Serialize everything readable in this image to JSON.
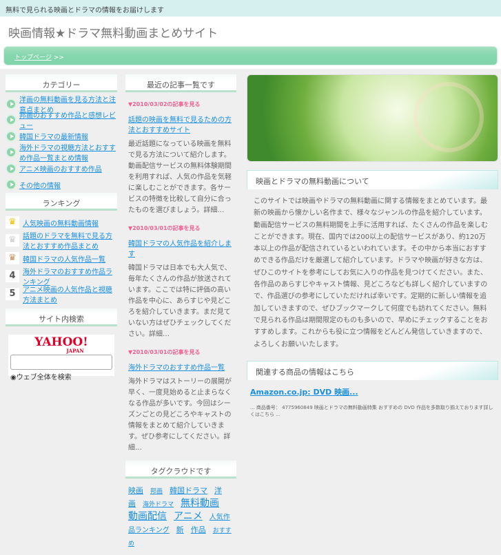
{
  "topbar": {
    "text": "無料で見られる映画とドラマの情報をお届けします"
  },
  "header": {
    "title": "映画情報★ドラマ無料動画まとめサイト"
  },
  "nav": {
    "home": "トップページ",
    "sep": " >>"
  },
  "left": {
    "categories_title": "カテゴリー",
    "categories": [
      "洋画の無料動画を見る方法と注意点まとめ",
      "邦画のおすすめ作品と感想レビュー",
      "韓国ドラマの最新情報",
      "海外ドラマの視聴方法とおすすめ作品一覧まとめ情報",
      "アニメ映画のおすすめ作品",
      "その他の情報"
    ],
    "ranking_title": "ランキング",
    "ranking": [
      {
        "rank": "1",
        "label": "人気映画の無料動画情報"
      },
      {
        "rank": "2",
        "label": "話題のドラマを無料で見る方法とおすすめ作品まとめ"
      },
      {
        "rank": "3",
        "label": "韓国ドラマの人気作品一覧"
      },
      {
        "rank": "4",
        "label": "海外ドラマのおすすめ作品ランキング"
      },
      {
        "rank": "5",
        "label": "アニメ映画の人気作品と視聴方法まとめ"
      }
    ],
    "search_title": "サイト内検索",
    "yahoo_logo": "YAHOO!",
    "yahoo_sub": "JAPAN",
    "search_placeholder": "",
    "radio_label": "ウェブ全体を検索"
  },
  "mid": {
    "recent_title": "最近の記事一覧です",
    "entries": [
      {
        "date": "▼2010/03/02",
        "date_suffix": "の記事を見る",
        "title": "話題の映画を無料で見るための方法とおすすめサイト",
        "body": "最近話題になっている映画を無料で見る方法について紹介します。動画配信サービスの無料体験期間を利用すれば、人気の作品を気軽に楽しむことができます。各サービスの特徴を比較して自分に合ったものを選びましょう。詳細…"
      },
      {
        "date": "▼2010/03/01",
        "date_suffix": "の記事を見る",
        "title": "韓国ドラマの人気作品を紹介します",
        "body": "韓国ドラマは日本でも大人気で、毎年たくさんの作品が放送されています。ここでは特に評価の高い作品を中心に、あらすじや見どころを紹介していきます。まだ見ていない方はぜひチェックしてください。詳細…"
      },
      {
        "date": "▼2010/03/01",
        "date_suffix": "の記事を見る",
        "title": "海外ドラマのおすすめ作品一覧",
        "body": "海外ドラマはストーリーの展開が早く、一度見始めると止まらなくなる作品が多いです。今回はシーズンごとの見どころやキャストの情報をまとめて紹介していきます。ぜひ参考にしてください。詳細…"
      }
    ],
    "tags_title": "タグクラウドです",
    "tags": [
      "映画",
      "邦画",
      "韓国ドラマ",
      "洋画",
      "海外ドラマ",
      "無料動画",
      "動画配信",
      "アニメ",
      "人気作品ランキング",
      "新",
      "作品",
      "おすすめ"
    ]
  },
  "right": {
    "intro_title": "映画とドラマの無料動画について",
    "intro_body": "このサイトでは映画やドラマの無料動画に関する情報をまとめています。最新の映画から懐かしい名作まで、様々なジャンルの作品を紹介しています。動画配信サービスの無料期間を上手に活用すれば、たくさんの作品を楽しむことができます。現在、国内では200以上の配信サービスがあり、約120万本以上の作品が配信されているといわれています。その中から本当におすすめできる作品だけを厳選して紹介しています。ドラマや映画が好きな方は、ぜひこのサイトを参考にしてお気に入りの作品を見つけてください。また、各作品のあらすじやキャスト情報、見どころなども詳しく紹介していますので、作品選びの参考にしていただければ幸いです。定期的に新しい情報を追加していきますので、ぜひブックマークして何度でも訪れてください。無料で見られる作品は期間限定のものも多いので、早めにチェックすることをおすすめします。これからも役に立つ情報をどんどん発信していきますので、よろしくお願いいたします。",
    "related_title": "関連する商品の情報はこちら",
    "amazon_title": "Amazon.co.jp: DVD 映画...",
    "amazon_desc": "... 商品番号： 4775960849 映画とドラマの無料動画特集 おすすめの DVD 作品を多数取り揃えております詳しくはこちら ..."
  }
}
